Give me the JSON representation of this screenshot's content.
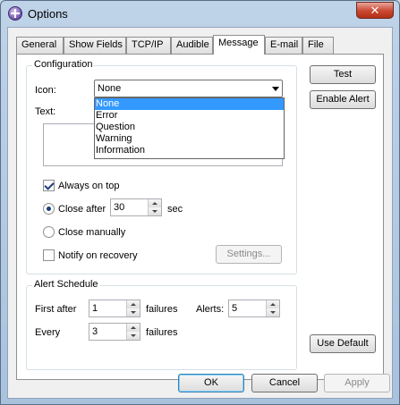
{
  "window": {
    "title": "Options",
    "close_glyph": "✕",
    "icon": "app-options-icon"
  },
  "tabs": [
    {
      "label": "General"
    },
    {
      "label": "Show Fields"
    },
    {
      "label": "TCP/IP"
    },
    {
      "label": "Audible"
    },
    {
      "label": "Message",
      "active": true
    },
    {
      "label": "E-mail"
    },
    {
      "label": "File"
    }
  ],
  "configuration": {
    "title": "Configuration",
    "icon_label": "Icon:",
    "icon_value": "None",
    "icon_options": [
      "None",
      "Error",
      "Question",
      "Warning",
      "Information"
    ],
    "text_label": "Text:",
    "always_on_top": {
      "label": "Always on top",
      "checked": true
    },
    "close_after": {
      "label": "Close after",
      "value": "30",
      "unit": "sec",
      "selected": true
    },
    "close_manually": {
      "label": "Close manually",
      "selected": false
    },
    "notify_on_recovery": {
      "label": "Notify on recovery",
      "checked": false
    },
    "settings_button": "Settings..."
  },
  "side_buttons": {
    "test": "Test",
    "enable_alert": "Enable Alert",
    "use_default": "Use Default"
  },
  "alert_schedule": {
    "title": "Alert Schedule",
    "first_after_label": "First after",
    "first_after_value": "1",
    "failures_label": "failures",
    "alerts_label": "Alerts:",
    "alerts_value": "5",
    "every_label": "Every",
    "every_value": "3"
  },
  "footer": {
    "ok": "OK",
    "cancel": "Cancel",
    "apply": "Apply"
  },
  "colors": {
    "selection": "#3399ff",
    "close_button": "#c9462f"
  }
}
